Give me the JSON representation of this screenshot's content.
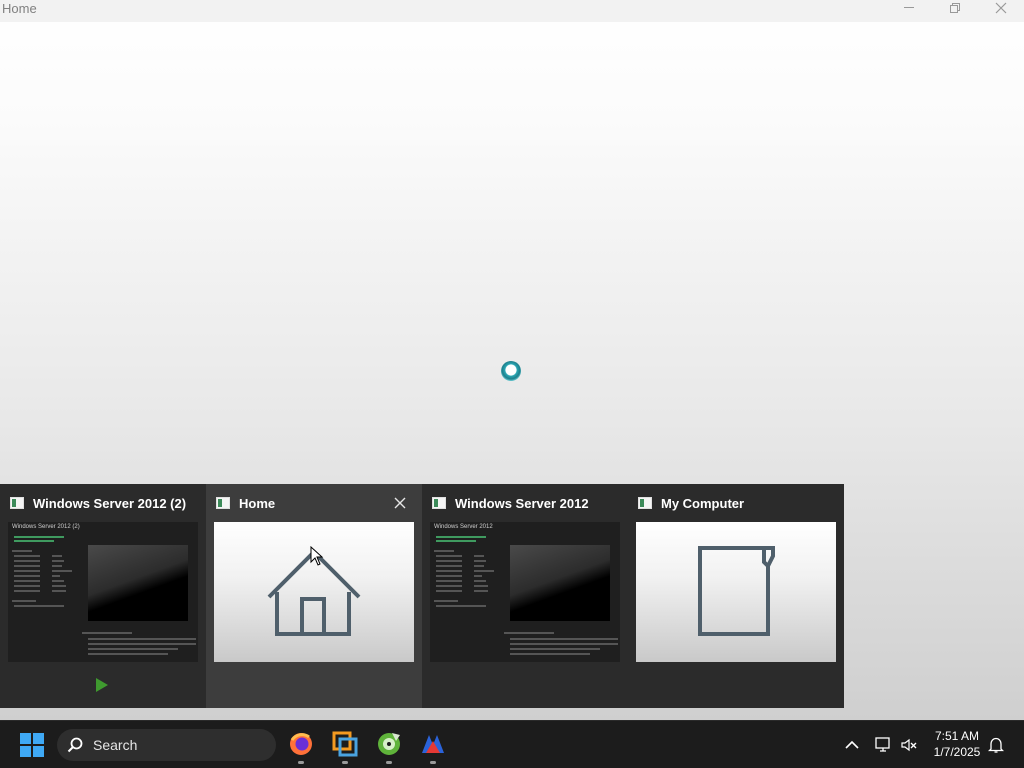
{
  "window": {
    "title": "Home",
    "controls": {
      "minimize": "minimize-icon",
      "maximize": "restore-icon",
      "close": "close-icon"
    }
  },
  "thumbnails": [
    {
      "title": "Windows Server 2012 (2)",
      "preview": "vm-details",
      "active": false,
      "paused": true
    },
    {
      "title": "Home",
      "preview": "home-icon",
      "active": true,
      "close": "close-icon"
    },
    {
      "title": "Windows Server 2012",
      "preview": "vm-details",
      "active": false
    },
    {
      "title": "My Computer",
      "preview": "computer-icon",
      "active": false
    }
  ],
  "mini_preview": {
    "vm1_title": "Windows Server 2012 (2)",
    "vm2_title": "Windows Server 2012"
  },
  "taskbar": {
    "search_placeholder": "Search",
    "pinned": [
      "firefox-icon",
      "vmware-icon",
      "cd-burner-icon",
      "rad-studio-icon"
    ]
  },
  "tray": {
    "time": "7:51 AM",
    "date": "1/7/2025",
    "icons": [
      "chevron-up-icon",
      "network-icon",
      "volume-muted-icon",
      "notification-bell-icon"
    ]
  },
  "colors": {
    "accent": "#2aa7b3",
    "play": "#3f9a2f",
    "taskbar": "#1c1c1c"
  }
}
